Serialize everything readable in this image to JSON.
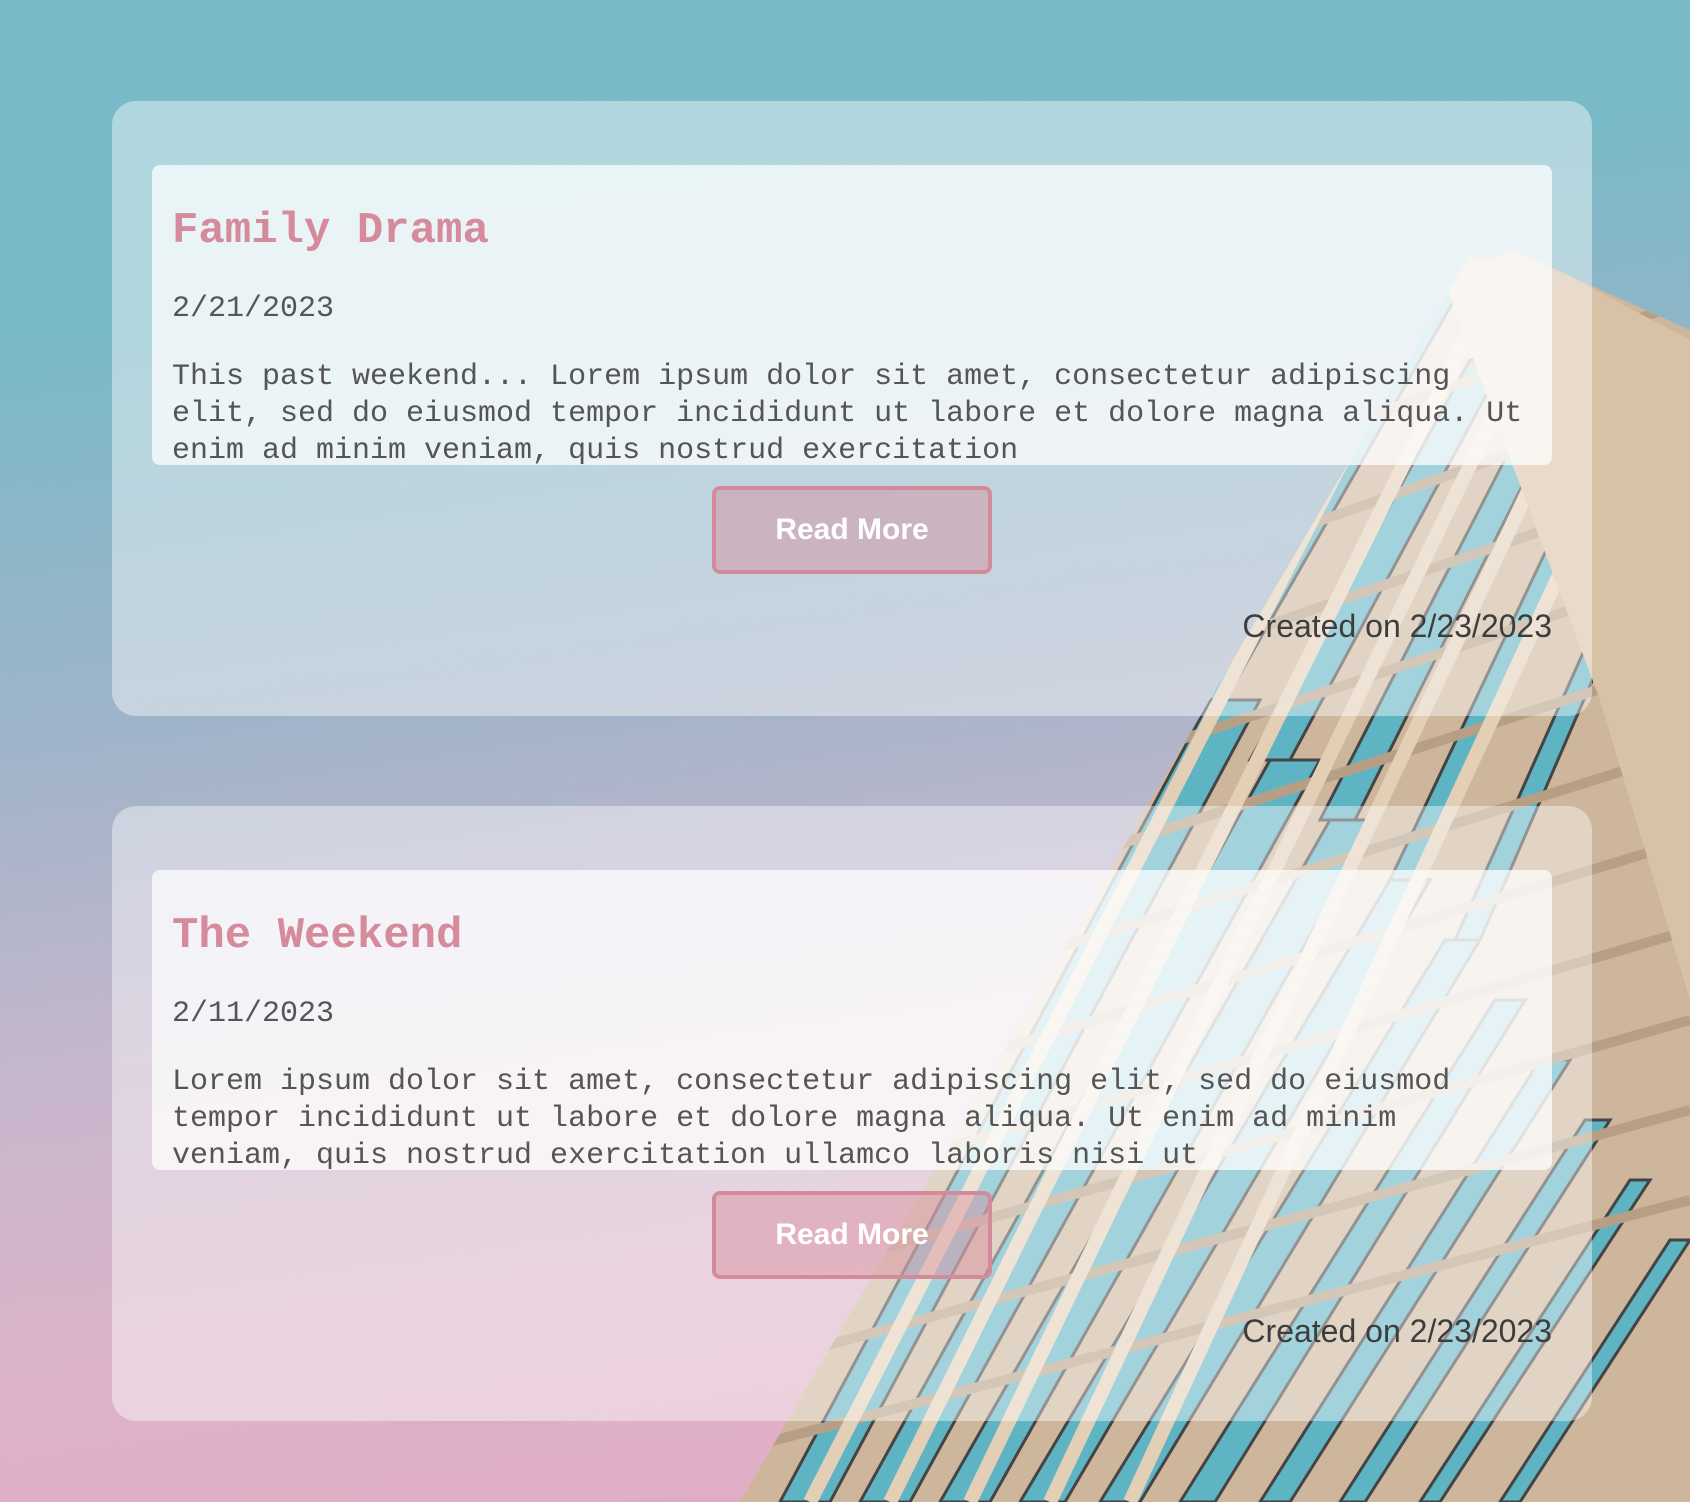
{
  "background": {
    "image": "skyscraper-photo",
    "gradient_colors": [
      "#77bbc9",
      "#a3b4c9",
      "#dcb3c9",
      "#e4a9c3"
    ]
  },
  "posts": [
    {
      "title": "Family Drama",
      "date": "2/21/2023",
      "body": "This past weekend... Lorem ipsum dolor sit amet, consectetur adipiscing elit, sed do eiusmod tempor incididunt ut labore et dolore magna aliqua. Ut enim ad minim veniam, quis nostrud exercitation",
      "read_more_label": "Read More",
      "created_on": "Created on 2/23/2023"
    },
    {
      "title": "The Weekend",
      "date": "2/11/2023",
      "body": "Lorem ipsum dolor sit amet, consectetur adipiscing elit, sed do eiusmod tempor incididunt ut labore et dolore magna aliqua. Ut enim ad minim veniam, quis nostrud exercitation ullamco laboris nisi ut",
      "read_more_label": "Read More",
      "created_on": "Created on 2/23/2023"
    }
  ],
  "colors": {
    "title": "#d68b9c",
    "button_border": "#d38a9a",
    "text": "#555555"
  }
}
